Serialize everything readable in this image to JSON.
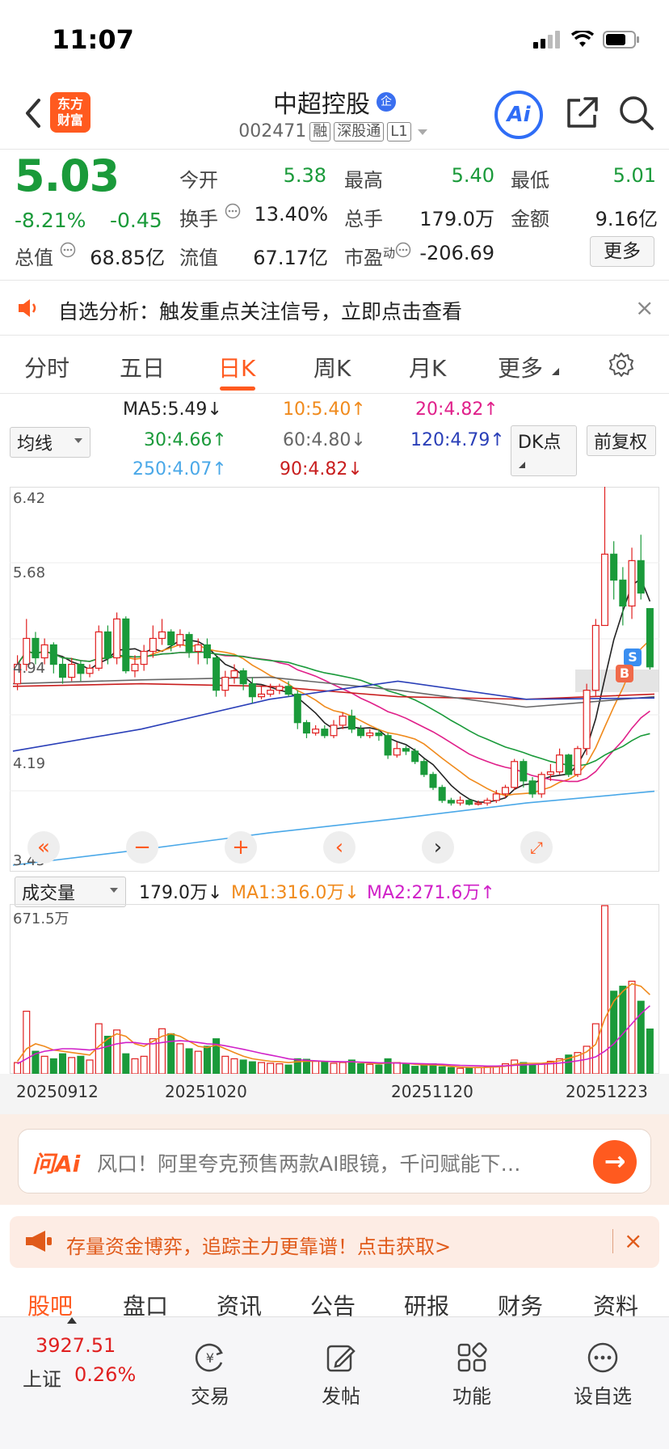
{
  "status_bar": {
    "time": "11:07"
  },
  "header": {
    "logo_line1": "东方",
    "logo_line2": "财富",
    "stock_name": "中超控股",
    "enterprise_badge": "企",
    "stock_code": "002471",
    "tags": [
      "融",
      "深股通",
      "L1"
    ],
    "ai_label": "Ai"
  },
  "quote": {
    "price": "5.03",
    "change_pct": "-8.21%",
    "change_amt": "-0.45",
    "open_label": "今开",
    "open_value": "5.38",
    "high_label": "最高",
    "high_value": "5.40",
    "low_label": "最低",
    "low_value": "5.01",
    "turnover_label": "换手",
    "turnover_value": "13.40%",
    "volume_label": "总手",
    "volume_value": "179.0万",
    "amount_label": "金额",
    "amount_value": "9.16亿",
    "mktcap_label": "总值",
    "mktcap_value": "68.85亿",
    "float_label": "流值",
    "float_value": "67.17亿",
    "pe_label": "市盈",
    "pe_sup": "动",
    "pe_value": "-206.69",
    "more_label": "更多"
  },
  "notice": {
    "text": "自选分析：触发重点关注信号，立即点击查看",
    "close": "×"
  },
  "tabs": [
    "分时",
    "五日",
    "日K",
    "周K",
    "月K",
    "更多"
  ],
  "ma_legend": {
    "selector": "均线",
    "items": [
      {
        "text": "MA5:5.49",
        "arrow": "↓",
        "color": "#222222"
      },
      {
        "text": "10:5.40",
        "arrow": "↑",
        "color": "#f08a1c"
      },
      {
        "text": "20:4.82",
        "arrow": "↑",
        "color": "#e0208a"
      },
      {
        "text": "30:4.66",
        "arrow": "↑",
        "color": "#1a9a3a"
      },
      {
        "text": "60:4.80",
        "arrow": "↓",
        "color": "#666666"
      },
      {
        "text": "120:4.79",
        "arrow": "↑",
        "color": "#2a3fb8"
      },
      {
        "text": "250:4.07",
        "arrow": "↑",
        "color": "#4aa8e8"
      },
      {
        "text": "90:4.82",
        "arrow": "↓",
        "color": "#c81e1e"
      }
    ],
    "dk_label": "DK点",
    "adjust_label": "前复权"
  },
  "price_axis": [
    "6.42",
    "5.68",
    "4.94",
    "4.19",
    "3.45"
  ],
  "volume_panel": {
    "selector": "成交量",
    "vol": "179.0万↓",
    "ma1": "MA1:316.0万↓",
    "ma2": "MA2:271.6万↑",
    "max_label": "671.5万"
  },
  "dates": [
    "20250912",
    "20251020",
    "20251120",
    "20251223"
  ],
  "signals": {
    "buy": "B",
    "sell": "S"
  },
  "ai_bar": {
    "logo": "问Ai",
    "text": "风口！阿里夸克预售两款AI眼镜，千问赋能下…"
  },
  "promo": {
    "text": "存量资金博弈，追踪主力更靠谱！点击获取>",
    "close": "×"
  },
  "sub_tabs": [
    "股吧",
    "盘口",
    "资讯",
    "公告",
    "研报",
    "财务",
    "资料"
  ],
  "bottom_nav": {
    "index_value": "3927.51",
    "index_label": "上证",
    "index_pct": "0.26%",
    "items": [
      "交易",
      "发帖",
      "功能",
      "设自选"
    ]
  },
  "chart_data": {
    "type": "candlestick",
    "price_range": [
      3.45,
      6.42
    ],
    "candles": [
      [
        4.9,
        5.05,
        5.12,
        4.85
      ],
      [
        5.05,
        5.25,
        5.4,
        5.0
      ],
      [
        5.25,
        5.1,
        5.3,
        5.05
      ],
      [
        5.1,
        5.2,
        5.25,
        5.05
      ],
      [
        5.2,
        5.05,
        5.22,
        4.98
      ],
      [
        5.05,
        4.95,
        5.1,
        4.9
      ],
      [
        4.95,
        5.05,
        5.1,
        4.92
      ],
      [
        5.05,
        4.98,
        5.08,
        4.92
      ],
      [
        4.98,
        5.02,
        5.05,
        4.95
      ],
      [
        5.02,
        5.3,
        5.35,
        5.0
      ],
      [
        5.3,
        5.1,
        5.35,
        5.05
      ],
      [
        5.1,
        5.4,
        5.45,
        5.05
      ],
      [
        5.4,
        5.0,
        5.42,
        4.98
      ],
      [
        5.0,
        5.05,
        5.12,
        4.95
      ],
      [
        5.05,
        5.15,
        5.2,
        5.0
      ],
      [
        5.15,
        5.25,
        5.35,
        5.1
      ],
      [
        5.25,
        5.3,
        5.4,
        5.2
      ],
      [
        5.3,
        5.2,
        5.32,
        5.15
      ],
      [
        5.2,
        5.28,
        5.32,
        5.18
      ],
      [
        5.28,
        5.15,
        5.3,
        5.1
      ],
      [
        5.15,
        5.2,
        5.25,
        5.05
      ],
      [
        5.2,
        5.1,
        5.25,
        5.05
      ],
      [
        5.1,
        4.85,
        5.12,
        4.8
      ],
      [
        4.85,
        4.95,
        5.0,
        4.8
      ],
      [
        4.95,
        5.0,
        5.05,
        4.9
      ],
      [
        5.0,
        4.9,
        5.02,
        4.85
      ],
      [
        4.9,
        4.8,
        4.95,
        4.75
      ],
      [
        4.8,
        4.82,
        4.88,
        4.78
      ],
      [
        4.82,
        4.85,
        4.9,
        4.8
      ],
      [
        4.85,
        4.88,
        4.9,
        4.82
      ],
      [
        4.88,
        4.82,
        4.92,
        4.8
      ],
      [
        4.82,
        4.6,
        4.85,
        4.55
      ],
      [
        4.6,
        4.52,
        4.62,
        4.48
      ],
      [
        4.52,
        4.55,
        4.58,
        4.5
      ],
      [
        4.55,
        4.5,
        4.58,
        4.48
      ],
      [
        4.5,
        4.58,
        4.62,
        4.48
      ],
      [
        4.58,
        4.65,
        4.68,
        4.55
      ],
      [
        4.65,
        4.55,
        4.7,
        4.52
      ],
      [
        4.55,
        4.5,
        4.58,
        4.48
      ],
      [
        4.5,
        4.52,
        4.55,
        4.48
      ],
      [
        4.52,
        4.5,
        4.55,
        4.46
      ],
      [
        4.5,
        4.35,
        4.52,
        4.32
      ],
      [
        4.35,
        4.4,
        4.45,
        4.33
      ],
      [
        4.4,
        4.38,
        4.42,
        4.35
      ],
      [
        4.38,
        4.3,
        4.4,
        4.28
      ],
      [
        4.3,
        4.2,
        4.32,
        4.18
      ],
      [
        4.2,
        4.1,
        4.22,
        4.08
      ],
      [
        4.1,
        4.0,
        4.12,
        3.98
      ],
      [
        4.0,
        3.98,
        4.02,
        3.96
      ],
      [
        3.98,
        4.0,
        4.03,
        3.96
      ],
      [
        4.0,
        3.97,
        4.01,
        3.96
      ],
      [
        3.97,
        3.98,
        4.0,
        3.96
      ],
      [
        3.98,
        4.0,
        4.02,
        3.96
      ],
      [
        4.0,
        4.05,
        4.08,
        3.98
      ],
      [
        4.05,
        4.1,
        4.12,
        4.02
      ],
      [
        4.1,
        4.3,
        4.32,
        4.08
      ],
      [
        4.3,
        4.15,
        4.32,
        4.1
      ],
      [
        4.15,
        4.05,
        4.18,
        4.02
      ],
      [
        4.05,
        4.2,
        4.22,
        4.02
      ],
      [
        4.2,
        4.22,
        4.28,
        4.15
      ],
      [
        4.22,
        4.35,
        4.4,
        4.2
      ],
      [
        4.35,
        4.2,
        4.36,
        4.18
      ],
      [
        4.2,
        4.4,
        4.42,
        4.18
      ],
      [
        4.4,
        4.85,
        4.9,
        4.35
      ],
      [
        4.85,
        5.35,
        5.4,
        4.8
      ],
      [
        5.35,
        5.9,
        6.42,
        5.6
      ],
      [
        5.9,
        5.7,
        6.0,
        5.55
      ],
      [
        5.7,
        5.5,
        5.8,
        5.35
      ],
      [
        5.5,
        5.85,
        5.95,
        5.4
      ],
      [
        5.85,
        5.6,
        6.05,
        5.55
      ],
      [
        5.48,
        5.03,
        5.4,
        5.01
      ]
    ],
    "volumes": [
      45,
      250,
      90,
      70,
      60,
      80,
      65,
      70,
      55,
      200,
      150,
      175,
      80,
      60,
      70,
      140,
      180,
      160,
      120,
      100,
      90,
      110,
      140,
      70,
      60,
      55,
      48,
      45,
      42,
      40,
      35,
      60,
      58,
      50,
      48,
      42,
      45,
      55,
      40,
      38,
      35,
      60,
      45,
      38,
      30,
      35,
      40,
      28,
      25,
      22,
      24,
      26,
      28,
      30,
      40,
      55,
      45,
      35,
      40,
      50,
      60,
      75,
      85,
      110,
      200,
      672,
      330,
      350,
      370,
      290,
      179
    ],
    "ma1_line": [
      50,
      100,
      120,
      110,
      95,
      90,
      85,
      80,
      75,
      110,
      140,
      160,
      150,
      120,
      110,
      130,
      150,
      160,
      150,
      130,
      110,
      105,
      115,
      100,
      85,
      70,
      60,
      55,
      50,
      48,
      45,
      48,
      50,
      50,
      50,
      48,
      47,
      48,
      45,
      43,
      40,
      44,
      44,
      42,
      38,
      36,
      36,
      34,
      30,
      27,
      26,
      25,
      26,
      27,
      30,
      38,
      42,
      42,
      42,
      46,
      52,
      62,
      72,
      88,
      118,
      220,
      290,
      330,
      360,
      350,
      316
    ],
    "ma2_line": [
      40,
      60,
      80,
      90,
      95,
      100,
      100,
      98,
      95,
      100,
      110,
      120,
      125,
      125,
      120,
      120,
      125,
      130,
      132,
      130,
      125,
      120,
      118,
      112,
      105,
      98,
      90,
      82,
      75,
      68,
      60,
      56,
      54,
      52,
      50,
      49,
      48,
      48,
      47,
      46,
      44,
      44,
      43,
      42,
      41,
      40,
      39,
      38,
      36,
      34,
      33,
      32,
      31,
      31,
      32,
      34,
      36,
      37,
      38,
      40,
      43,
      47,
      52,
      58,
      68,
      90,
      120,
      160,
      200,
      240,
      272
    ]
  }
}
